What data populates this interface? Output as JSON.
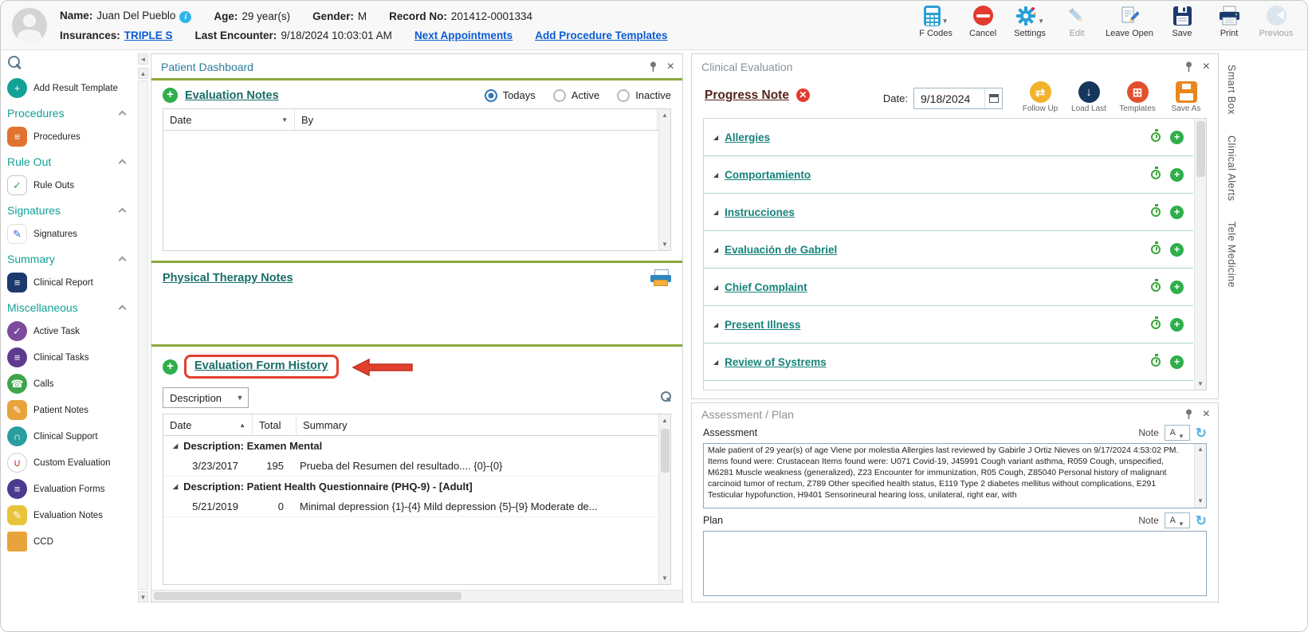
{
  "colors": {
    "accent_teal": "#12a197",
    "link_blue": "#0b5bd3",
    "olive_divider": "#8ba83c",
    "plus_green": "#2eaf4b",
    "alert_red": "#e2402f"
  },
  "header": {
    "name_label": "Name:",
    "name_value": "Juan Del Pueblo",
    "age_label": "Age:",
    "age_value": "29 year(s)",
    "gender_label": "Gender:",
    "gender_value": "M",
    "record_label": "Record No:",
    "record_value": "201412-0001334",
    "insurances_label": "Insurances:",
    "insurances_value": "TRIPLE S",
    "last_encounter_label": "Last Encounter:",
    "last_encounter_value": "9/18/2024 10:03:01 AM",
    "next_appointments_link": "Next Appointments",
    "add_procedure_templates_link": "Add Procedure Templates",
    "toolbar": [
      {
        "label": "F Codes"
      },
      {
        "label": "Cancel"
      },
      {
        "label": "Settings"
      },
      {
        "label": "Edit"
      },
      {
        "label": "Leave Open"
      },
      {
        "label": "Save"
      },
      {
        "label": "Print"
      },
      {
        "label": "Previous"
      }
    ]
  },
  "sidebar": {
    "add_result_template": "Add Result Template",
    "sections": [
      {
        "title": "Procedures",
        "items": [
          "Procedures"
        ]
      },
      {
        "title": "Rule Out",
        "items": [
          "Rule Outs"
        ]
      },
      {
        "title": "Signatures",
        "items": [
          "Signatures"
        ]
      },
      {
        "title": "Summary",
        "items": [
          "Clinical Report"
        ]
      },
      {
        "title": "Miscellaneous",
        "items": [
          "Active Task",
          "Clinical Tasks",
          "Calls",
          "Patient Notes",
          "Clinical Support",
          "Custom Evaluation",
          "Evaluation Forms",
          "Evaluation Notes",
          "CCD"
        ]
      }
    ]
  },
  "dashboard": {
    "title": "Patient Dashboard",
    "evaluation_notes": {
      "title": "Evaluation Notes",
      "filters": [
        "Todays",
        "Active",
        "Inactive"
      ],
      "selected_filter": "Todays",
      "columns": [
        "Date",
        "By"
      ]
    },
    "physical_therapy_title": "Physical Therapy Notes",
    "form_history": {
      "title": "Evaluation Form History",
      "filter_value": "Description",
      "columns": [
        "Date",
        "Total",
        "Summary"
      ],
      "groups": [
        {
          "label": "Description: Examen Mental",
          "rows": [
            {
              "date": "3/23/2017",
              "total": "195",
              "summary": "Prueba del Resumen del resultado.... {0}-{0}"
            }
          ]
        },
        {
          "label": "Description: Patient Health Questionnaire (PHQ-9) - [Adult]",
          "rows": [
            {
              "date": "5/21/2019",
              "total": "0",
              "summary": "Minimal depression {1}-{4}  Mild depression {5}-{9}  Moderate de..."
            }
          ]
        }
      ]
    }
  },
  "clinical_evaluation": {
    "title": "Clinical Evaluation",
    "note_title": "Progress Note",
    "date_label": "Date:",
    "date_value": "9/18/2024",
    "actions": [
      "Follow Up",
      "Load Last",
      "Templates",
      "Save As"
    ],
    "sections": [
      "Allergies",
      "Comportamiento",
      "Instrucciones",
      "Evaluación de Gabriel",
      "Chief Complaint",
      "Present Illness",
      "Review of Systrems"
    ]
  },
  "assessment_plan": {
    "title": "Assessment / Plan",
    "assessment_label": "Assessment",
    "plan_label": "Plan",
    "note_label": "Note",
    "note_style_button": "A",
    "assessment_text": "Male patient of 29 year(s) of age Viene por molestia    Allergies last reviewed by Gabirle J Ortiz Nieves on 9/17/2024 4:53:02 PM.   Items found were:  Crustacean  Items found were:  U071 Covid-19, J45991 Cough variant asthma, R059 Cough, unspecified, M6281 Muscle weakness (generalized), Z23 Encounter for immunization, R05 Cough, Z85040 Personal history of malignant carcinoid tumor of rectum, Z789 Other specified health status, E119 Type 2 diabetes mellitus without complications, E291 Testicular hypofunction, H9401 Sensorineural hearing loss, unilateral, right ear, with"
  },
  "side_tabs": [
    "Smart Box",
    "Clinical Alerts",
    "Tele Medicine"
  ]
}
